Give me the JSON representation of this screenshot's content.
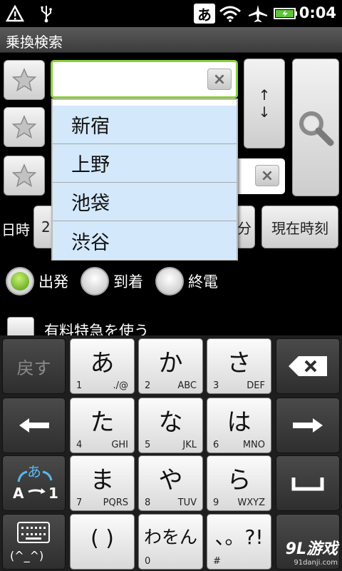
{
  "status_bar": {
    "ime_indicator": "あ",
    "time": "0:04",
    "icons": [
      "warning-icon",
      "usb-icon",
      "wifi-icon",
      "airplane-icon",
      "battery-icon"
    ]
  },
  "title": "乗換検索",
  "search_form": {
    "swap_up": "↑",
    "swap_down": "↓",
    "clear_glyph": "×",
    "datetime_label": "日時",
    "date_value_partial": "20",
    "minute_suffix": "分",
    "now_button": "現在時刻",
    "departure": "出発",
    "arrival": "到着",
    "last_train": "終電",
    "selected_mode": "出発",
    "paid_express": "有料特急を使う"
  },
  "suggestions": [
    "新宿",
    "上野",
    "池袋",
    "渋谷"
  ],
  "keyboard": {
    "back": "戻す",
    "row1": [
      {
        "kana": "あ",
        "num": "1",
        "sub": "./@"
      },
      {
        "kana": "か",
        "num": "2",
        "sub": "ABC"
      },
      {
        "kana": "さ",
        "num": "3",
        "sub": "DEF"
      }
    ],
    "row2": [
      {
        "kana": "た",
        "num": "4",
        "sub": "GHI"
      },
      {
        "kana": "な",
        "num": "5",
        "sub": "JKL"
      },
      {
        "kana": "は",
        "num": "6",
        "sub": "MNO"
      }
    ],
    "row3": [
      {
        "kana": "ま",
        "num": "7",
        "sub": "PQRS"
      },
      {
        "kana": "や",
        "num": "8",
        "sub": "TUV"
      },
      {
        "kana": "ら",
        "num": "9",
        "sub": "WXYZ"
      }
    ],
    "row4": [
      {
        "kana": "( )",
        "num": "",
        "sub": ""
      },
      {
        "kana": "わをん",
        "num": "0",
        "sub": ""
      },
      {
        "kana": "、。?!",
        "num": "#",
        "sub": ""
      }
    ],
    "mode_kana": "あ",
    "mode_alpha": "A",
    "mode_num": "1",
    "emoticon": "(^_^)"
  },
  "watermark": {
    "brand": "9L游戏",
    "url": "91danji.com"
  },
  "colors": {
    "focus_border": "#8ccf3a",
    "suggestion_bg": "#d3e8fa",
    "radio_on": "#4e9a10"
  }
}
